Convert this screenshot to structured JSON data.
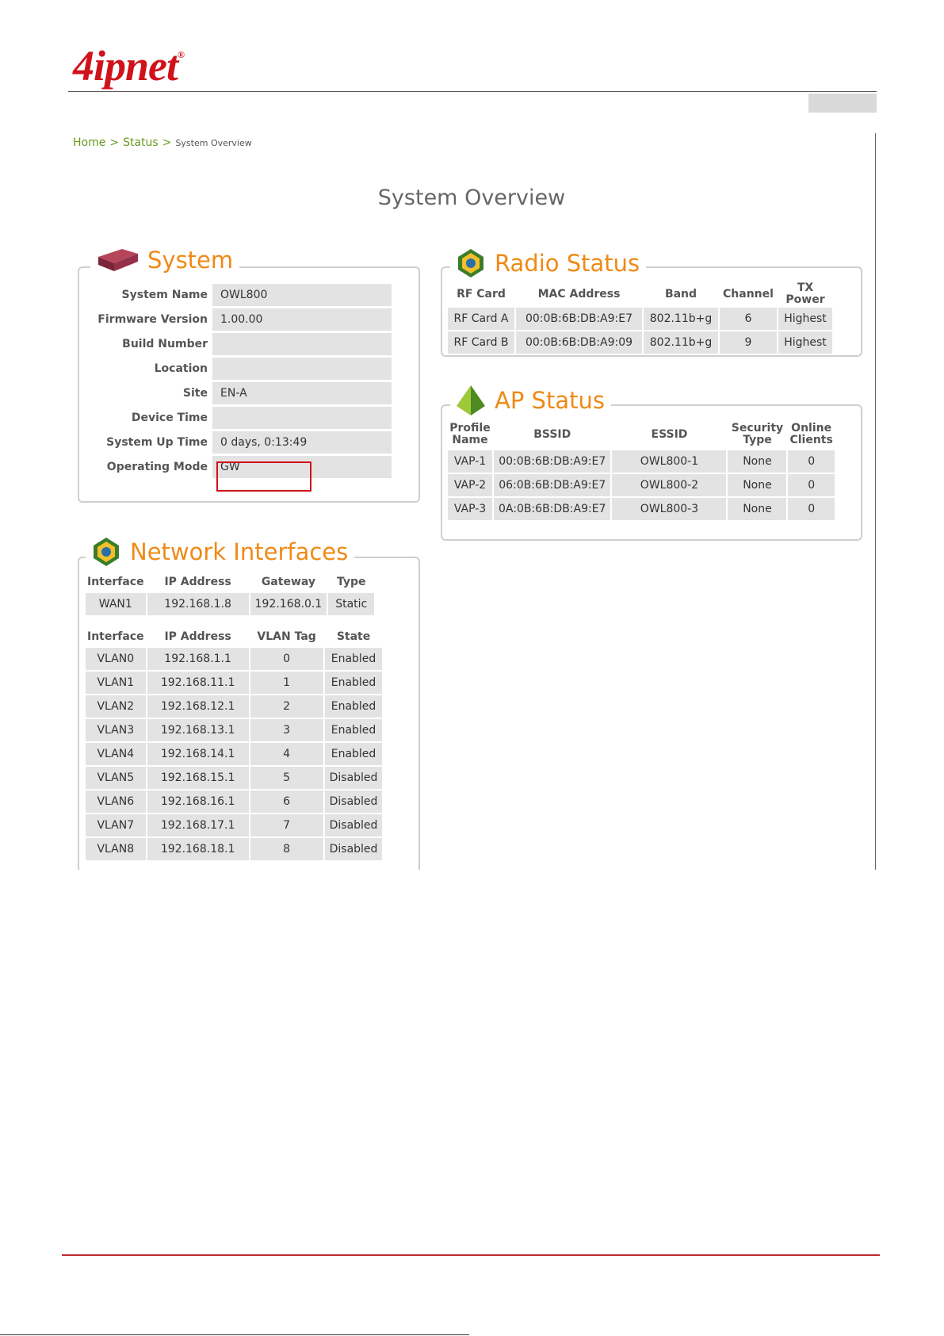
{
  "brand": {
    "logo_text": "4ipnet",
    "reg_mark": "®"
  },
  "breadcrumb": {
    "home": "Home",
    "separator": ">",
    "status": "Status",
    "current": "System Overview"
  },
  "page_title": "System Overview",
  "system": {
    "title": "System",
    "icon": "router-device-icon",
    "rows": [
      {
        "label": "System Name",
        "value": "OWL800"
      },
      {
        "label": "Firmware Version",
        "value": "1.00.00"
      },
      {
        "label": "Build Number",
        "value": ""
      },
      {
        "label": "Location",
        "value": ""
      },
      {
        "label": "Site",
        "value": "EN-A"
      },
      {
        "label": "Device Time",
        "value": ""
      },
      {
        "label": "System Up Time",
        "value": "0 days, 0:13:49"
      },
      {
        "label": "Operating Mode",
        "value": "GW"
      }
    ]
  },
  "radio_status": {
    "title": "Radio Status",
    "icon": "network-emblem-icon",
    "headers": [
      "RF Card",
      "MAC Address",
      "Band",
      "Channel",
      "TX Power"
    ],
    "rows": [
      [
        "RF Card A",
        "00:0B:6B:DB:A9:E7",
        "802.11b+g",
        "6",
        "Highest"
      ],
      [
        "RF Card B",
        "00:0B:6B:DB:A9:09",
        "802.11b+g",
        "9",
        "Highest"
      ]
    ]
  },
  "ap_status": {
    "title": "AP Status",
    "icon": "pyramid-icon",
    "headers": [
      "Profile Name",
      "BSSID",
      "ESSID",
      "Security Type",
      "Online Clients"
    ],
    "rows": [
      [
        "VAP-1",
        "00:0B:6B:DB:A9:E7",
        "OWL800-1",
        "None",
        "0"
      ],
      [
        "VAP-2",
        "06:0B:6B:DB:A9:E7",
        "OWL800-2",
        "None",
        "0"
      ],
      [
        "VAP-3",
        "0A:0B:6B:DB:A9:E7",
        "OWL800-3",
        "None",
        "0"
      ]
    ]
  },
  "network_interfaces": {
    "title": "Network Interfaces",
    "icon": "network-emblem-icon",
    "wan_headers": [
      "Interface",
      "IP Address",
      "Gateway",
      "Type"
    ],
    "wan_rows": [
      [
        "WAN1",
        "192.168.1.8",
        "192.168.0.1",
        "Static"
      ]
    ],
    "vlan_headers": [
      "Interface",
      "IP Address",
      "VLAN Tag",
      "State"
    ],
    "vlan_rows": [
      [
        "VLAN0",
        "192.168.1.1",
        "0",
        "Enabled"
      ],
      [
        "VLAN1",
        "192.168.11.1",
        "1",
        "Enabled"
      ],
      [
        "VLAN2",
        "192.168.12.1",
        "2",
        "Enabled"
      ],
      [
        "VLAN3",
        "192.168.13.1",
        "3",
        "Enabled"
      ],
      [
        "VLAN4",
        "192.168.14.1",
        "4",
        "Enabled"
      ],
      [
        "VLAN5",
        "192.168.15.1",
        "5",
        "Disabled"
      ],
      [
        "VLAN6",
        "192.168.16.1",
        "6",
        "Disabled"
      ],
      [
        "VLAN7",
        "192.168.17.1",
        "7",
        "Disabled"
      ],
      [
        "VLAN8",
        "192.168.18.1",
        "8",
        "Disabled"
      ]
    ]
  },
  "colors": {
    "accent": "#ef8a16",
    "link": "#6a9a1e",
    "brand_red": "#d0121b",
    "cell_bg": "#e3e3e3"
  }
}
